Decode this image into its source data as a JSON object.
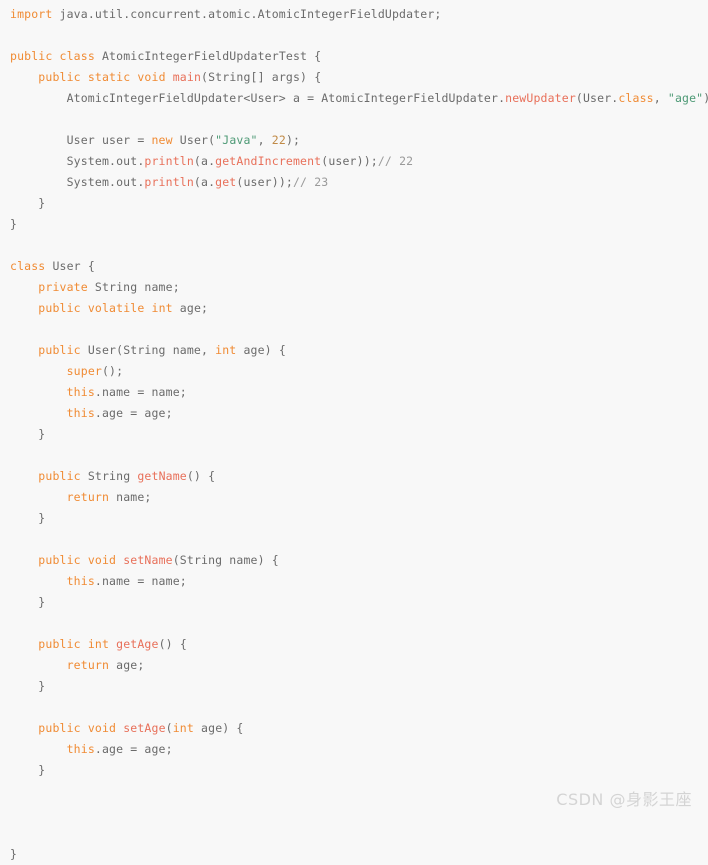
{
  "editor": {
    "background": "#f8f8f8",
    "language": "java",
    "colors": {
      "keyword": "#f08b34",
      "method": "#e8705a",
      "string": "#4e9a76",
      "number": "#c08a47",
      "comment": "#9a9a9a",
      "plain": "#6b6b6b",
      "watermark": "#d4d4d4"
    },
    "lines": [
      {
        "id": 1,
        "tokens": [
          {
            "t": "import",
            "c": "keyword"
          },
          {
            "t": " java.util.concurrent.atomic.AtomicIntegerFieldUpdater;",
            "c": "plain"
          }
        ]
      },
      {
        "id": 2,
        "tokens": []
      },
      {
        "id": 3,
        "tokens": [
          {
            "t": "public",
            "c": "keyword"
          },
          {
            "t": " ",
            "c": "plain"
          },
          {
            "t": "class",
            "c": "keyword"
          },
          {
            "t": " AtomicIntegerFieldUpdaterTest {",
            "c": "plain"
          }
        ]
      },
      {
        "id": 4,
        "tokens": [
          {
            "t": "    ",
            "c": "plain"
          },
          {
            "t": "public",
            "c": "keyword"
          },
          {
            "t": " ",
            "c": "plain"
          },
          {
            "t": "static",
            "c": "keyword"
          },
          {
            "t": " ",
            "c": "plain"
          },
          {
            "t": "void",
            "c": "keyword"
          },
          {
            "t": " ",
            "c": "plain"
          },
          {
            "t": "main",
            "c": "method"
          },
          {
            "t": "(String[] args) {",
            "c": "plain"
          }
        ]
      },
      {
        "id": 5,
        "tokens": [
          {
            "t": "        AtomicIntegerFieldUpdater<User> a = AtomicIntegerFieldUpdater.",
            "c": "plain"
          },
          {
            "t": "newUpdater",
            "c": "method"
          },
          {
            "t": "(User.",
            "c": "plain"
          },
          {
            "t": "class",
            "c": "keyword"
          },
          {
            "t": ", ",
            "c": "plain"
          },
          {
            "t": "\"age\"",
            "c": "string"
          },
          {
            "t": ");",
            "c": "plain"
          }
        ]
      },
      {
        "id": 6,
        "tokens": []
      },
      {
        "id": 7,
        "tokens": [
          {
            "t": "        User user = ",
            "c": "plain"
          },
          {
            "t": "new",
            "c": "keyword"
          },
          {
            "t": " User(",
            "c": "plain"
          },
          {
            "t": "\"Java\"",
            "c": "string"
          },
          {
            "t": ", ",
            "c": "plain"
          },
          {
            "t": "22",
            "c": "number"
          },
          {
            "t": ");",
            "c": "plain"
          }
        ]
      },
      {
        "id": 8,
        "tokens": [
          {
            "t": "        System.out.",
            "c": "plain"
          },
          {
            "t": "println",
            "c": "method"
          },
          {
            "t": "(a.",
            "c": "plain"
          },
          {
            "t": "getAndIncrement",
            "c": "method"
          },
          {
            "t": "(user));",
            "c": "plain"
          },
          {
            "t": "// 22",
            "c": "comment"
          }
        ]
      },
      {
        "id": 9,
        "tokens": [
          {
            "t": "        System.out.",
            "c": "plain"
          },
          {
            "t": "println",
            "c": "method"
          },
          {
            "t": "(a.",
            "c": "plain"
          },
          {
            "t": "get",
            "c": "method"
          },
          {
            "t": "(user));",
            "c": "plain"
          },
          {
            "t": "// 23",
            "c": "comment"
          }
        ]
      },
      {
        "id": 10,
        "tokens": [
          {
            "t": "    }",
            "c": "plain"
          }
        ]
      },
      {
        "id": 11,
        "tokens": [
          {
            "t": "}",
            "c": "plain"
          }
        ]
      },
      {
        "id": 12,
        "tokens": []
      },
      {
        "id": 13,
        "tokens": [
          {
            "t": "class",
            "c": "keyword"
          },
          {
            "t": " User {",
            "c": "plain"
          }
        ]
      },
      {
        "id": 14,
        "tokens": [
          {
            "t": "    ",
            "c": "plain"
          },
          {
            "t": "private",
            "c": "keyword"
          },
          {
            "t": " String name;",
            "c": "plain"
          }
        ]
      },
      {
        "id": 15,
        "tokens": [
          {
            "t": "    ",
            "c": "plain"
          },
          {
            "t": "public",
            "c": "keyword"
          },
          {
            "t": " ",
            "c": "plain"
          },
          {
            "t": "volatile",
            "c": "keyword"
          },
          {
            "t": " ",
            "c": "plain"
          },
          {
            "t": "int",
            "c": "keyword"
          },
          {
            "t": " age;",
            "c": "plain"
          }
        ]
      },
      {
        "id": 16,
        "tokens": []
      },
      {
        "id": 17,
        "tokens": [
          {
            "t": "    ",
            "c": "plain"
          },
          {
            "t": "public",
            "c": "keyword"
          },
          {
            "t": " User(String name, ",
            "c": "plain"
          },
          {
            "t": "int",
            "c": "keyword"
          },
          {
            "t": " age) {",
            "c": "plain"
          }
        ]
      },
      {
        "id": 18,
        "tokens": [
          {
            "t": "        ",
            "c": "plain"
          },
          {
            "t": "super",
            "c": "keyword"
          },
          {
            "t": "();",
            "c": "plain"
          }
        ]
      },
      {
        "id": 19,
        "tokens": [
          {
            "t": "        ",
            "c": "plain"
          },
          {
            "t": "this",
            "c": "keyword"
          },
          {
            "t": ".name = name;",
            "c": "plain"
          }
        ]
      },
      {
        "id": 20,
        "tokens": [
          {
            "t": "        ",
            "c": "plain"
          },
          {
            "t": "this",
            "c": "keyword"
          },
          {
            "t": ".age = age;",
            "c": "plain"
          }
        ]
      },
      {
        "id": 21,
        "tokens": [
          {
            "t": "    }",
            "c": "plain"
          }
        ]
      },
      {
        "id": 22,
        "tokens": []
      },
      {
        "id": 23,
        "tokens": [
          {
            "t": "    ",
            "c": "plain"
          },
          {
            "t": "public",
            "c": "keyword"
          },
          {
            "t": " String ",
            "c": "plain"
          },
          {
            "t": "getName",
            "c": "method"
          },
          {
            "t": "() {",
            "c": "plain"
          }
        ]
      },
      {
        "id": 24,
        "tokens": [
          {
            "t": "        ",
            "c": "plain"
          },
          {
            "t": "return",
            "c": "keyword"
          },
          {
            "t": " name;",
            "c": "plain"
          }
        ]
      },
      {
        "id": 25,
        "tokens": [
          {
            "t": "    }",
            "c": "plain"
          }
        ]
      },
      {
        "id": 26,
        "tokens": []
      },
      {
        "id": 27,
        "tokens": [
          {
            "t": "    ",
            "c": "plain"
          },
          {
            "t": "public",
            "c": "keyword"
          },
          {
            "t": " ",
            "c": "plain"
          },
          {
            "t": "void",
            "c": "keyword"
          },
          {
            "t": " ",
            "c": "plain"
          },
          {
            "t": "setName",
            "c": "method"
          },
          {
            "t": "(String name) {",
            "c": "plain"
          }
        ]
      },
      {
        "id": 28,
        "tokens": [
          {
            "t": "        ",
            "c": "plain"
          },
          {
            "t": "this",
            "c": "keyword"
          },
          {
            "t": ".name = name;",
            "c": "plain"
          }
        ]
      },
      {
        "id": 29,
        "tokens": [
          {
            "t": "    }",
            "c": "plain"
          }
        ]
      },
      {
        "id": 30,
        "tokens": []
      },
      {
        "id": 31,
        "tokens": [
          {
            "t": "    ",
            "c": "plain"
          },
          {
            "t": "public",
            "c": "keyword"
          },
          {
            "t": " ",
            "c": "plain"
          },
          {
            "t": "int",
            "c": "keyword"
          },
          {
            "t": " ",
            "c": "plain"
          },
          {
            "t": "getAge",
            "c": "method"
          },
          {
            "t": "() {",
            "c": "plain"
          }
        ]
      },
      {
        "id": 32,
        "tokens": [
          {
            "t": "        ",
            "c": "plain"
          },
          {
            "t": "return",
            "c": "keyword"
          },
          {
            "t": " age;",
            "c": "plain"
          }
        ]
      },
      {
        "id": 33,
        "tokens": [
          {
            "t": "    }",
            "c": "plain"
          }
        ]
      },
      {
        "id": 34,
        "tokens": []
      },
      {
        "id": 35,
        "tokens": [
          {
            "t": "    ",
            "c": "plain"
          },
          {
            "t": "public",
            "c": "keyword"
          },
          {
            "t": " ",
            "c": "plain"
          },
          {
            "t": "void",
            "c": "keyword"
          },
          {
            "t": " ",
            "c": "plain"
          },
          {
            "t": "setAge",
            "c": "method"
          },
          {
            "t": "(",
            "c": "plain"
          },
          {
            "t": "int",
            "c": "keyword"
          },
          {
            "t": " age) {",
            "c": "plain"
          }
        ]
      },
      {
        "id": 36,
        "tokens": [
          {
            "t": "        ",
            "c": "plain"
          },
          {
            "t": "this",
            "c": "keyword"
          },
          {
            "t": ".age = age;",
            "c": "plain"
          }
        ]
      },
      {
        "id": 37,
        "tokens": [
          {
            "t": "    }",
            "c": "plain"
          }
        ]
      },
      {
        "id": 38,
        "tokens": []
      },
      {
        "id": 39,
        "tokens": []
      },
      {
        "id": 40,
        "tokens": []
      },
      {
        "id": 41,
        "tokens": [
          {
            "t": "}",
            "c": "plain"
          }
        ]
      }
    ]
  },
  "watermark": {
    "text": "CSDN @身影王座"
  }
}
